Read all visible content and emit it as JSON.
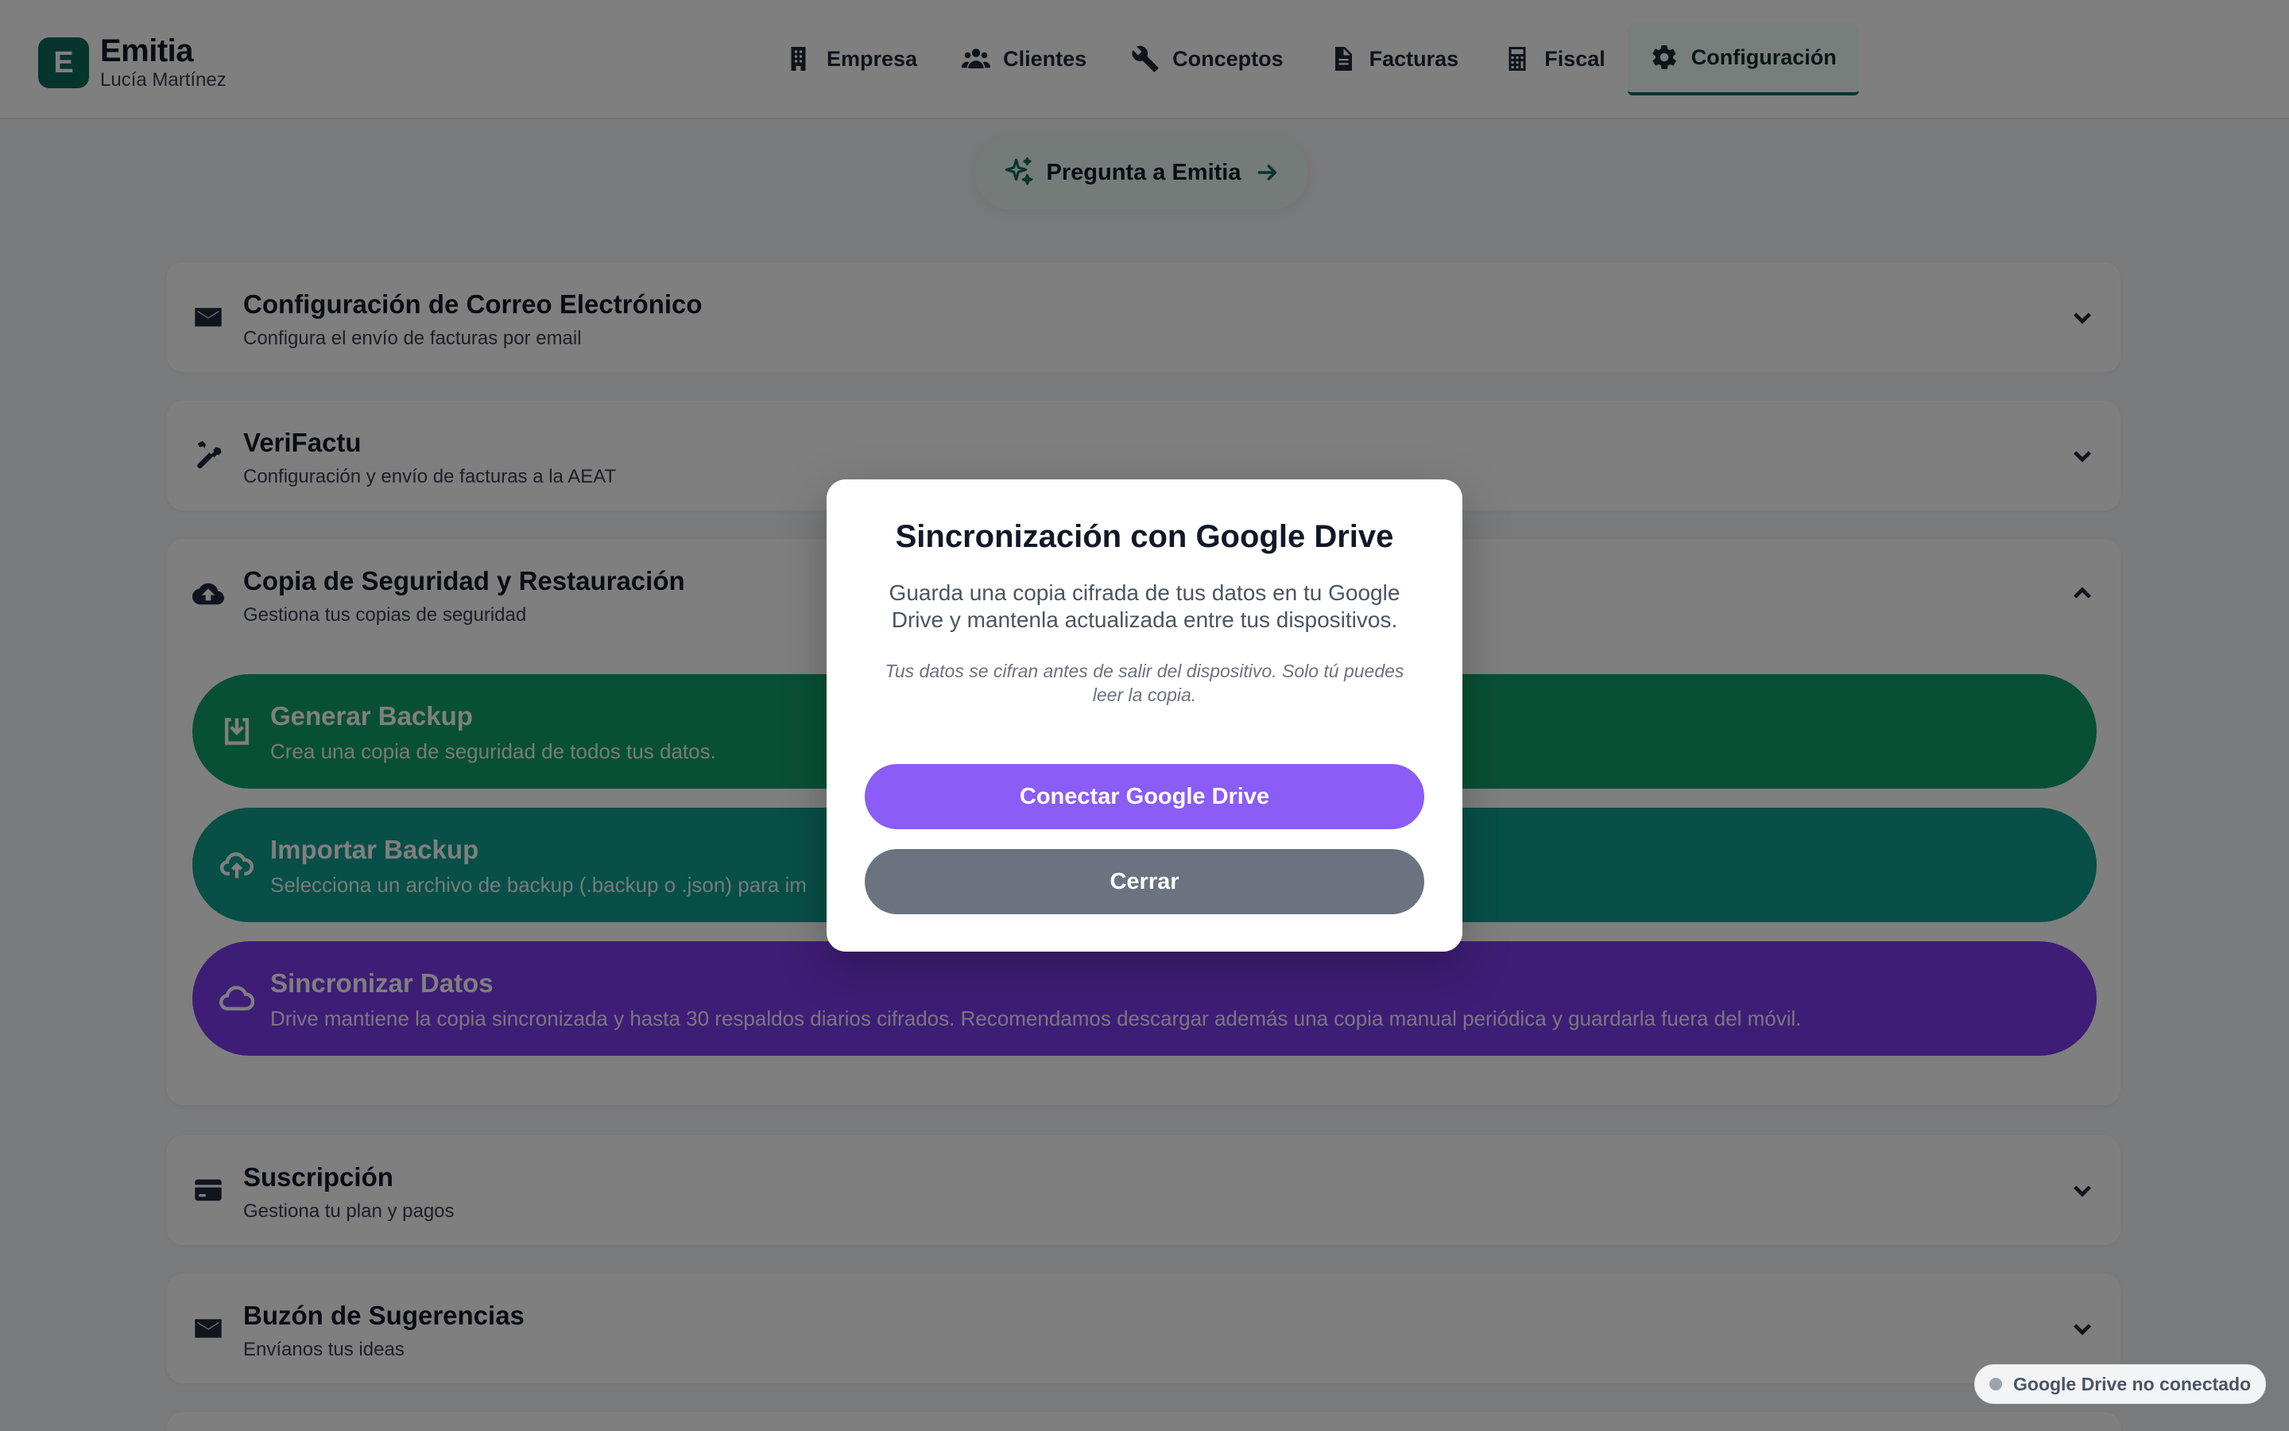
{
  "brand": {
    "logo_letter": "E",
    "name": "Emitia",
    "user": "Lucía Martínez"
  },
  "nav": [
    {
      "label": "Empresa",
      "icon": "building-icon"
    },
    {
      "label": "Clientes",
      "icon": "users-icon"
    },
    {
      "label": "Conceptos",
      "icon": "wrench-icon"
    },
    {
      "label": "Facturas",
      "icon": "document-icon"
    },
    {
      "label": "Fiscal",
      "icon": "calculator-icon"
    },
    {
      "label": "Configuración",
      "icon": "gear-icon",
      "active": true
    }
  ],
  "ask": {
    "label": "Pregunta a Emitia"
  },
  "sections": {
    "email": {
      "title": "Configuración de Correo Electrónico",
      "subtitle": "Configura el envío de facturas por email"
    },
    "verifactu": {
      "title": "VeriFactu",
      "subtitle": "Configuración y envío de facturas a la AEAT"
    },
    "backup": {
      "title": "Copia de Seguridad y Restauración",
      "subtitle": "Gestiona tus copias de seguridad",
      "expanded": true,
      "options": [
        {
          "title": "Generar Backup",
          "subtitle": "Crea una copia de seguridad de todos tus datos."
        },
        {
          "title": "Importar Backup",
          "subtitle": "Selecciona un archivo de backup (.backup o .json) para im"
        },
        {
          "title": "Sincronizar Datos",
          "subtitle": "Drive mantiene la copia sincronizada y hasta 30 respaldos diarios cifrados. Recomendamos descargar además una copia manual periódica y guardarla fuera del móvil."
        }
      ]
    },
    "subscription": {
      "title": "Suscripción",
      "subtitle": "Gestiona tu plan y pagos"
    },
    "suggestions": {
      "title": "Buzón de Sugerencias",
      "subtitle": "Envíanos tus ideas"
    }
  },
  "modal": {
    "title": "Sincronización con Google Drive",
    "description": "Guarda una copia cifrada de tus datos en tu Google Drive y mantenla actualizada entre tus dispositivos.",
    "note": "Tus datos se cifran antes de salir del dispositivo. Solo tú puedes leer la copia.",
    "connect_label": "Conectar Google Drive",
    "close_label": "Cerrar"
  },
  "status": {
    "label": "Google Drive no conectado"
  },
  "colors": {
    "brand": "#0d6b5b",
    "green": "#10a06b",
    "teal": "#0f9f8e",
    "purple": "#7c3aed",
    "connect": "#8b5cf6",
    "close": "#6b7280"
  }
}
